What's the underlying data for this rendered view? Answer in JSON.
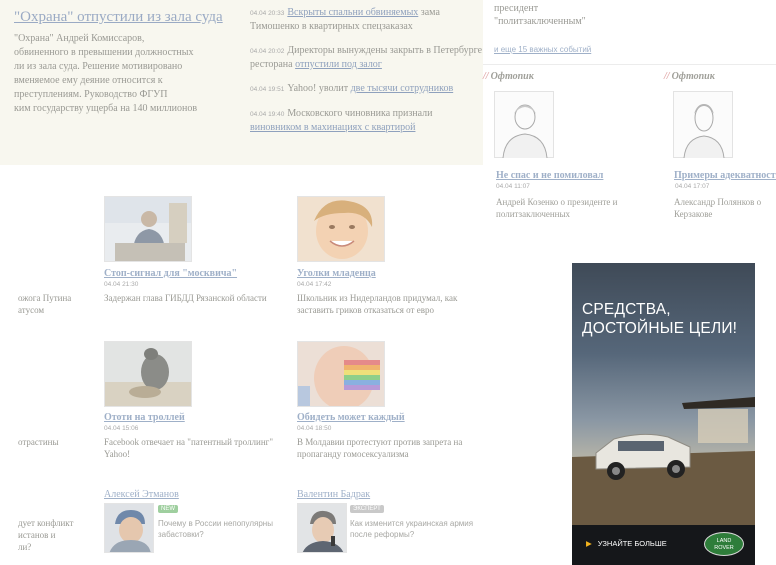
{
  "lead": {
    "title": "\"Охрана\" отпустили из зала суда",
    "lines": [
      "\"Охрана\" Андрей Комиссаров,",
      "обвиненного в превышении должностных",
      "ли из зала суда. Решение мотивировано",
      "вменяемое ему деяние относится к",
      "преступлениям. Руководство ФГУП",
      "ким государству ущерба на 140 миллионов"
    ]
  },
  "news": [
    {
      "time": "04.04 20:33",
      "prefix": "",
      "link": "Вскрыты спальни обвиняемых",
      "suffix": " зама Тимошенко в квартирных спецзаказах"
    },
    {
      "time": "04.04 20:02",
      "prefix": "Директоры вынуждены закрыть в Петербурге ресторана ",
      "link": "отпустили под залог",
      "suffix": ""
    },
    {
      "time": "04.04 19:51",
      "prefix": "Yahoo! уволит ",
      "link": "две тысячи сотрудников",
      "suffix": ""
    },
    {
      "time": "04.04 19:40",
      "prefix": "Московского чиновника признали ",
      "link": "виновником в махинациях с квартирой",
      "suffix": ""
    }
  ],
  "right_top": {
    "text_lines": [
      "пресидент",
      "\"политзаключенным\""
    ],
    "events_link": "и еще 15 важных событий"
  },
  "offtopic": {
    "label": "Офтопик",
    "mark": "//",
    "items": [
      {
        "title": "Не спас и не помиловал",
        "date": "04.04 11:07",
        "desc": "Андрей Козенко о президенте и политзаключенных"
      },
      {
        "title": "Примеры адекватности",
        "date": "04.04 17:07",
        "desc": "Александр Полянков о Керзакове"
      }
    ]
  },
  "cards": [
    {
      "title": "Стоп-сигнал для \"москвича\"",
      "date": "04.04 21:30",
      "desc": "Задержан глава ГИБДД Рязанской области"
    },
    {
      "title": "Уголки младенца",
      "date": "04.04 17:42",
      "desc": "Школьник из Нидерландов придумал, как заставить гриков отказаться от евро"
    },
    {
      "title": "Ототи на троллей",
      "date": "04.04 15:06",
      "desc": "Facebook отвечает на \"патентный троллинг\" Yahoo!"
    },
    {
      "title": "Обидеть может каждый",
      "date": "04.04 18:50",
      "desc": "В Молдавии протестуют против запрета на пропаганду гомосексуализма"
    }
  ],
  "edge_texts": [
    [
      "ожога Путина",
      "атусом"
    ],
    [
      "отрастины"
    ],
    [
      "дует конфликт",
      "истанов и",
      "ли?"
    ]
  ],
  "authors": [
    {
      "name": "Алексей Этманов",
      "badge": "NEW",
      "desc": "Почему в России непопулярны забастовки?"
    },
    {
      "name": "Валентин Бадрак",
      "badge": "ЭКСПЕРТ",
      "desc": "Как изменится украинская армия после реформы?"
    }
  ],
  "ad": {
    "headline_lines": [
      "СРЕДСТВА,",
      "ДОСТОЙНЫЕ ЦЕЛИ!"
    ],
    "cta": "УЗНАЙТЕ БОЛЬШЕ",
    "logo_lines": [
      "LAND",
      "ROVER"
    ]
  },
  "colors": {
    "background": "#ffffff",
    "top_band": "#f8f7ef",
    "link": "#9fb0c8",
    "ad_cta_arrow": "#f1b21e",
    "logo_green": "#2e7d3a"
  }
}
